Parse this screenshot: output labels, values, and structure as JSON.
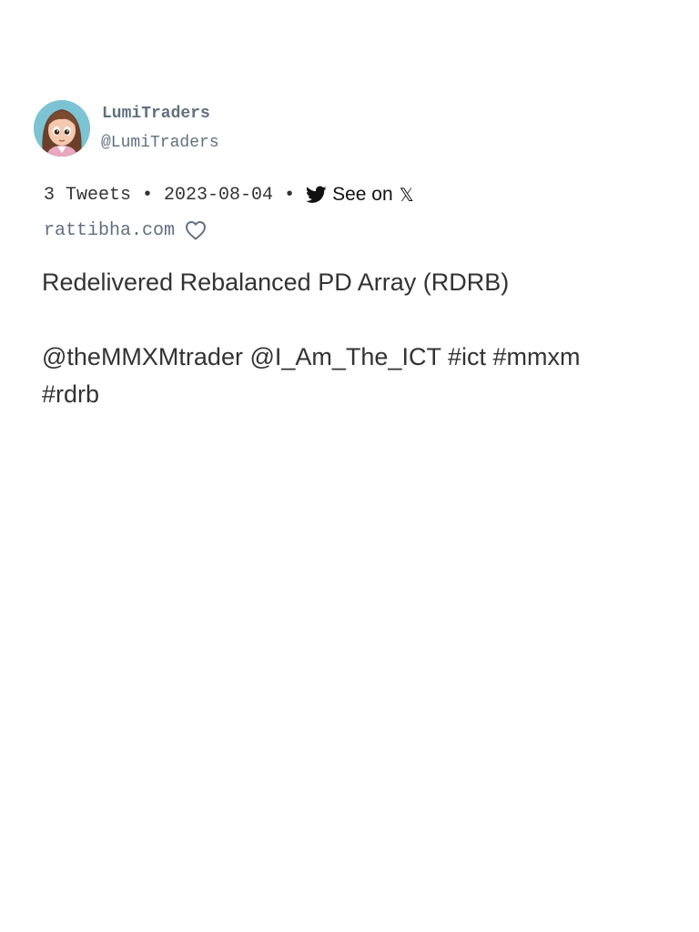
{
  "author": {
    "display_name": "LumiTraders",
    "handle": "@LumiTraders",
    "avatar_icon": "cartoon-girl-avatar"
  },
  "thread_meta": {
    "tweet_count": "3 Tweets",
    "separator": "•",
    "date": "2023-08-04",
    "see_on_label": "See on",
    "see_on_icon": "twitter-bird-icon",
    "x_glyph": "𝕏"
  },
  "source": {
    "site": "rattibha.com",
    "favorite_icon": "heart-outline-icon"
  },
  "tweet": {
    "lines": [
      "Redelivered Rebalanced PD Array (RDRB)",
      "",
      "@theMMXMtrader @I_Am_The_ICT #ict #mmxm",
      "#rdrb"
    ]
  },
  "colors": {
    "handle_gray": "#607080",
    "body_text": "#333333",
    "avatar_bg": "#7cc4d4"
  }
}
